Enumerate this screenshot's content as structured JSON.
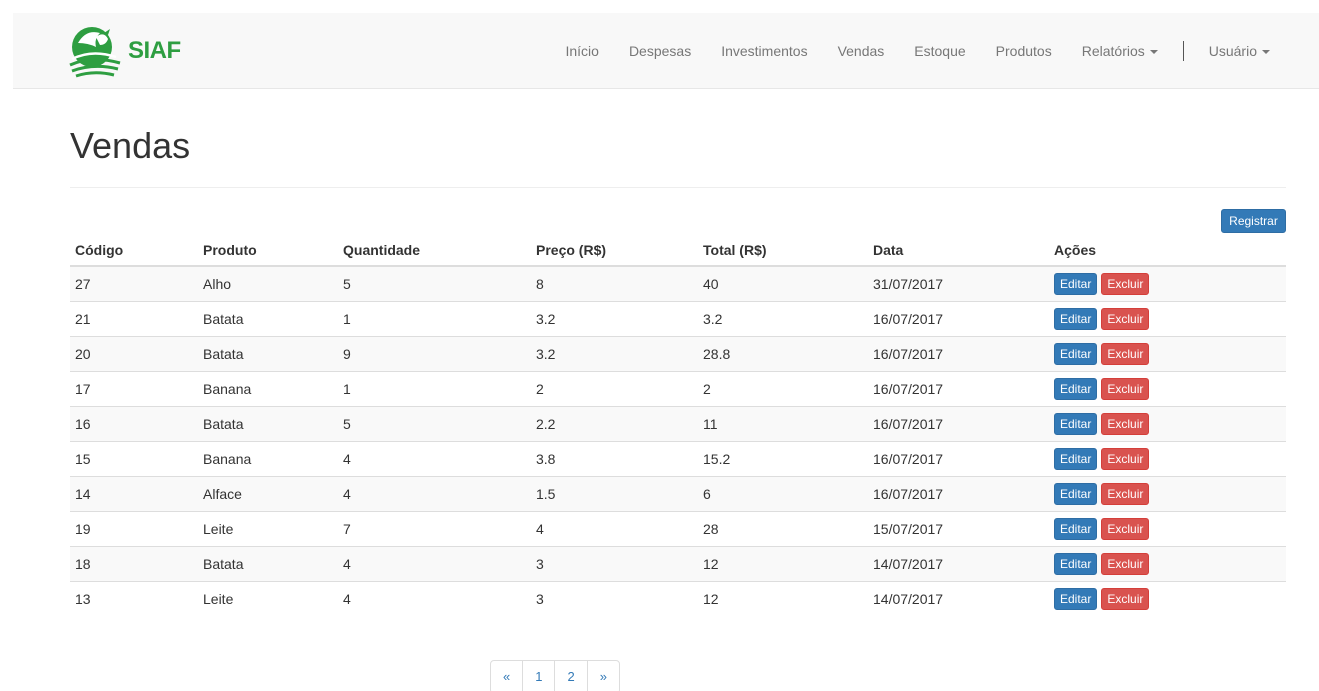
{
  "brand": {
    "name": "SIAF",
    "color": "#2e9e41"
  },
  "nav": {
    "items": [
      "Início",
      "Despesas",
      "Investimentos",
      "Vendas",
      "Estoque",
      "Produtos"
    ],
    "reports": "Relatórios",
    "user": "Usuário"
  },
  "page": {
    "title": "Vendas",
    "register_label": "Registrar"
  },
  "table": {
    "headers": [
      "Código",
      "Produto",
      "Quantidade",
      "Preço (R$)",
      "Total (R$)",
      "Data",
      "Ações"
    ],
    "rows": [
      [
        "27",
        "Alho",
        "5",
        "8",
        "40",
        "31/07/2017"
      ],
      [
        "21",
        "Batata",
        "1",
        "3.2",
        "3.2",
        "16/07/2017"
      ],
      [
        "20",
        "Batata",
        "9",
        "3.2",
        "28.8",
        "16/07/2017"
      ],
      [
        "17",
        "Banana",
        "1",
        "2",
        "2",
        "16/07/2017"
      ],
      [
        "16",
        "Batata",
        "5",
        "2.2",
        "11",
        "16/07/2017"
      ],
      [
        "15",
        "Banana",
        "4",
        "3.8",
        "15.2",
        "16/07/2017"
      ],
      [
        "14",
        "Alface",
        "4",
        "1.5",
        "6",
        "16/07/2017"
      ],
      [
        "19",
        "Leite",
        "7",
        "4",
        "28",
        "15/07/2017"
      ],
      [
        "18",
        "Batata",
        "4",
        "3",
        "12",
        "14/07/2017"
      ],
      [
        "13",
        "Leite",
        "4",
        "3",
        "12",
        "14/07/2017"
      ]
    ],
    "edit_label": "Editar",
    "delete_label": "Excluir"
  },
  "pagination": {
    "prev": "«",
    "pages": [
      "1",
      "2"
    ],
    "next": "»"
  },
  "colors": {
    "primary": "#337ab7",
    "danger": "#d9534f",
    "nav_text": "#777777"
  }
}
